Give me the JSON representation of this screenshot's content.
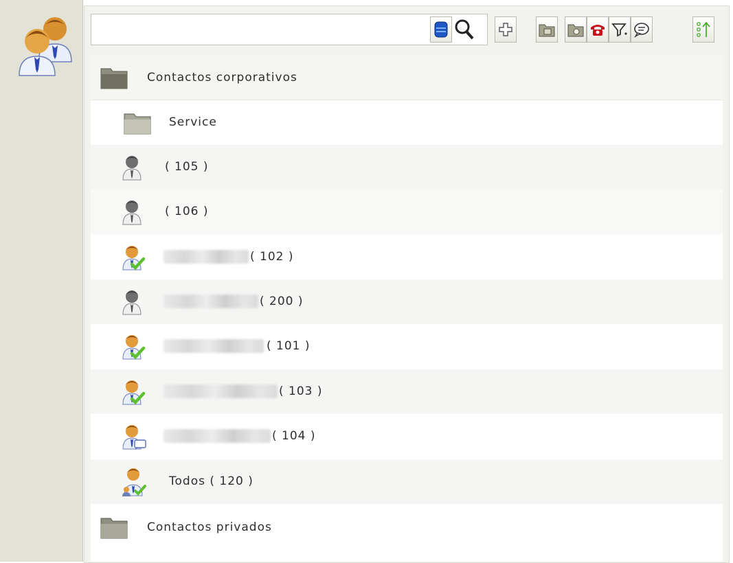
{
  "search": {
    "value": "",
    "placeholder": ""
  },
  "toolbar": {
    "buttons": [
      {
        "name": "database-icon"
      },
      {
        "name": "search-icon"
      },
      {
        "name": "add-icon"
      },
      {
        "name": "folder-tree-icon"
      },
      {
        "name": "folder-camera-icon"
      },
      {
        "name": "phone-icon"
      },
      {
        "name": "filter-icon"
      },
      {
        "name": "chat-icon"
      },
      {
        "name": "sort-icon"
      }
    ]
  },
  "contacts": {
    "corporate_group": "Contactos corporativos",
    "service_folder": "Service",
    "items": [
      {
        "ext": "( 105 )",
        "status": "offline"
      },
      {
        "ext": "( 106 )",
        "status": "offline"
      },
      {
        "ext": "( 102 )",
        "status": "available"
      },
      {
        "ext": "( 200 )",
        "status": "offline"
      },
      {
        "ext": "( 101 )",
        "status": "available"
      },
      {
        "ext": "( 103 )",
        "status": "available"
      },
      {
        "ext": "( 104 )",
        "status": "chat"
      }
    ],
    "all_label": "Todos ( 120 )",
    "private_group": "Contactos privados"
  },
  "colors": {
    "sidebar_bg": "#e2e2d6",
    "folder": "#8c8c80",
    "available": "#5cc031",
    "offline_user": "#7a7a7a",
    "user_orange": "#e39a3b",
    "tie_blue": "#2f47b5"
  }
}
